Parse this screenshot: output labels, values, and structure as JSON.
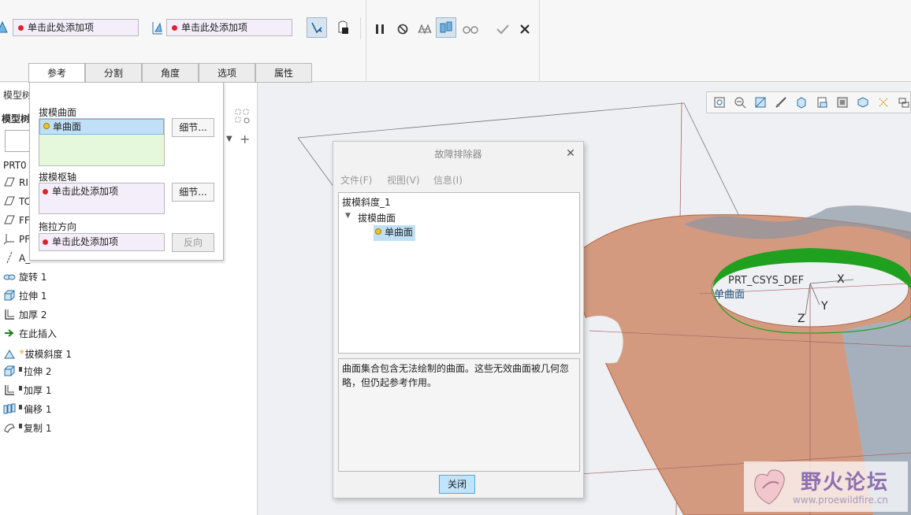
{
  "ribbon": {
    "collector1": "单击此处添加项",
    "collector2": "单击此处添加项",
    "tabs": [
      "参考",
      "分割",
      "角度",
      "选项",
      "属性"
    ]
  },
  "ref_panel": {
    "draft_surface_label": "拔模曲面",
    "draft_surface_item": "单曲面",
    "details_button": "细节...",
    "hinge_label": "拔模枢轴",
    "hinge_item": "单击此处添加项",
    "details_button2": "细节...",
    "pull_label": "拖拉方向",
    "pull_item": "单击此处添加项",
    "flip_button": "反向"
  },
  "model_tree": {
    "header1": "模型树",
    "header2": "模型树",
    "root": "PRT0",
    "items": [
      {
        "label": "RI",
        "icon": "datum-plane-icon"
      },
      {
        "label": "TC",
        "icon": "datum-plane-icon"
      },
      {
        "label": "FF",
        "icon": "datum-plane-icon"
      },
      {
        "label": "PF",
        "icon": "csys-icon"
      },
      {
        "label": "A_",
        "icon": "axis-icon"
      },
      {
        "label": "旋转 1",
        "icon": "revolve-icon"
      },
      {
        "label": "拉伸 1",
        "icon": "extrude-icon"
      },
      {
        "label": "加厚 2",
        "icon": "thicken-icon"
      },
      {
        "label": "在此插入",
        "icon": "insert-arrow-icon"
      },
      {
        "label": "拔模斜度 1",
        "icon": "draft-icon"
      },
      {
        "label": "拉伸 2",
        "icon": "extrude-icon"
      },
      {
        "label": "加厚 1",
        "icon": "thicken-icon"
      },
      {
        "label": "偏移 1",
        "icon": "offset-icon"
      },
      {
        "label": "复制 1",
        "icon": "copy-icon"
      }
    ]
  },
  "dialog": {
    "title": "故障排除器",
    "menu": [
      "文件(F)",
      "视图(V)",
      "信息(I)"
    ],
    "tree_root": "拔模斜度_1",
    "tree_child": "拔模曲面",
    "tree_leaf": "单曲面",
    "message": "曲面集合包含无法绘制的曲面。这些无效曲面被几何忽略，但仍起参考作用。",
    "close_button": "关闭"
  },
  "viewport": {
    "csys_label": "PRT_CSYS_DEF",
    "x_label": "X",
    "y_label": "Y",
    "z_label": "Z",
    "surface_label": "单曲面"
  },
  "watermark": {
    "title": "野火论坛",
    "url": "www.proewildfire.cn"
  },
  "colors": {
    "accent_blue": "#bfe4fb",
    "part_surface": "#d39a80",
    "highlight_green": "#1fa01f",
    "collector_bg": "#f4eefa"
  }
}
